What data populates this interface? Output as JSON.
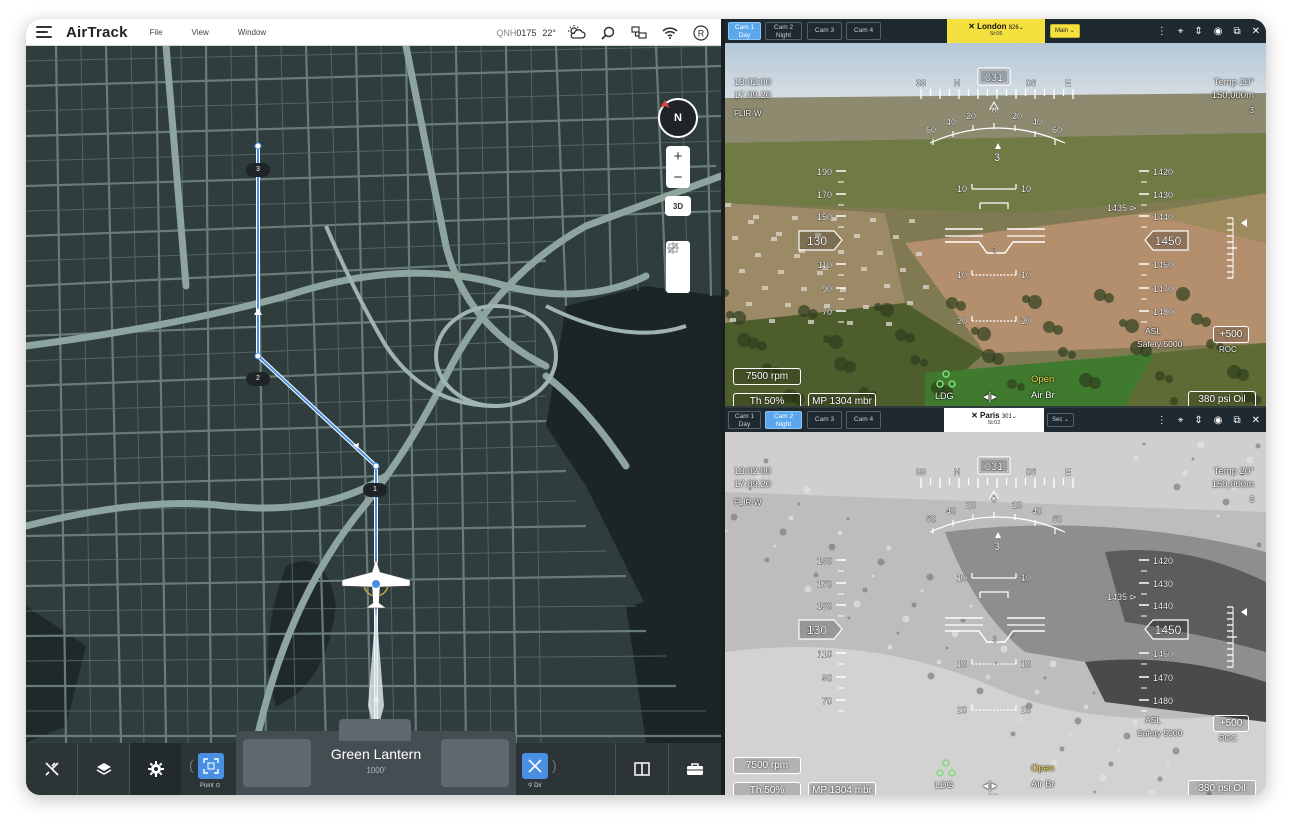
{
  "app": {
    "title": "AirTrack",
    "menu": [
      "File",
      "View",
      "Window"
    ],
    "qnh_label": "QNH",
    "qnh_value": "0175",
    "temperature": "22°"
  },
  "map": {
    "compass_label": "N",
    "zoom_in": "+",
    "zoom_out": "−",
    "mode_3d": "3D",
    "waypoints": [
      "1",
      "2",
      "3"
    ]
  },
  "bottombar": {
    "point_label": "Point",
    "aircraft_name": "Green Lantern",
    "aircraft_alt": "1000'",
    "dir_label": "Dir"
  },
  "cams": [
    {
      "tabs": [
        {
          "label": "Cam 1",
          "sub": "Day",
          "active": true
        },
        {
          "label": "Cam 2",
          "sub": "Night",
          "active": false
        },
        {
          "label": "Cam 3",
          "sub": "",
          "active": false
        },
        {
          "label": "Cam 4",
          "sub": "",
          "active": false
        }
      ],
      "location": "London",
      "location_num": "826",
      "station": "St:06",
      "location_bg": "#f4e13f",
      "mode": "Main"
    },
    {
      "tabs": [
        {
          "label": "Cam 1",
          "sub": "Day",
          "active": false
        },
        {
          "label": "Cam 2",
          "sub": "Night",
          "active": true
        },
        {
          "label": "Cam 3",
          "sub": "",
          "active": false
        },
        {
          "label": "Cam 4",
          "sub": "",
          "active": false
        }
      ],
      "location": "Paris",
      "location_num": "301",
      "station": "St:02",
      "location_bg": "#ffffff",
      "mode": "Sec"
    }
  ],
  "hud": {
    "time": "13:02:00",
    "date": "17.09.20",
    "sensor": "FLIR-W",
    "heading": "031",
    "heading_ticks": [
      "33",
      "N",
      "06",
      "E"
    ],
    "temp": "Temp 20°",
    "distance": "150,000m",
    "dist_sub": "3",
    "pitch_labels": [
      "60",
      "40",
      "20",
      "0",
      "20",
      "40",
      "60"
    ],
    "roll_center": "3",
    "speed_ticks": [
      "190",
      "170",
      "150",
      "110",
      "90",
      "70"
    ],
    "speed": "130",
    "alt_ticks": [
      "1420",
      "1430",
      "1440",
      "1460",
      "1470",
      "1480"
    ],
    "alt": "1450",
    "alt_bug": "1435",
    "ladder": [
      "10",
      "10",
      "20"
    ],
    "asl": "ASL",
    "safety": "Safety 5000",
    "roc": "+500",
    "roc_label": "ROC",
    "rpm": "7500 rpm",
    "throttle": "Th 50%",
    "mp": "MP 1304 mbr",
    "ldg": "LDG",
    "open": "Open",
    "air_br": "Air Br",
    "oil": "380 psi  Oil",
    "bottom_num": "10"
  },
  "colors": {
    "route": "#4a90e2",
    "accent": "#5aa7ee",
    "map_bg": "#2f3d3e",
    "map_roads": "#7f9590",
    "ldg_green": "#7be07b",
    "open_yellow": "#f2d94e"
  }
}
